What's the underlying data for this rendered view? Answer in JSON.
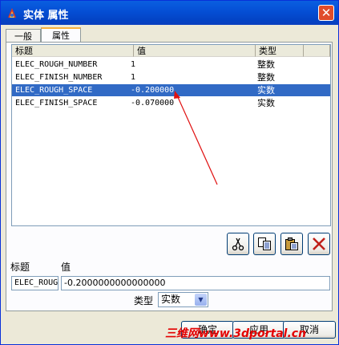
{
  "window": {
    "title": "实体 属性",
    "close_glyph": "✕"
  },
  "tabs": [
    {
      "label": "一般"
    },
    {
      "label": "属性"
    }
  ],
  "table": {
    "headers": {
      "title": "标题",
      "value": "值",
      "type": "类型"
    },
    "rows": [
      {
        "title": "ELEC_ROUGH_NUMBER",
        "value": "1",
        "type": "整数"
      },
      {
        "title": "ELEC_FINISH_NUMBER",
        "value": "1",
        "type": "整数"
      },
      {
        "title": "ELEC_ROUGH_SPACE",
        "value": "-0.200000",
        "type": "实数",
        "selected": true
      },
      {
        "title": "ELEC_FINISH_SPACE",
        "value": "-0.070000",
        "type": "实数"
      }
    ]
  },
  "toolbar": {
    "cut": "cut-icon",
    "copy": "copy-icon",
    "paste": "paste-icon",
    "delete": "delete-icon"
  },
  "edit": {
    "title_label": "标题",
    "value_label": "值",
    "title_value": "ELEC_ROUGH_SPACE",
    "value_value": "-0.2000000000000000",
    "type_label": "类型",
    "type_value": "实数"
  },
  "buttons": {
    "ok": "确定",
    "apply": "应用",
    "cancel": "取消"
  },
  "watermark": "三维网www.3dportal.cn",
  "colors": {
    "selection": "#316ac5",
    "titlebar": "#0550d6",
    "annotation_arrow": "#e01010"
  }
}
